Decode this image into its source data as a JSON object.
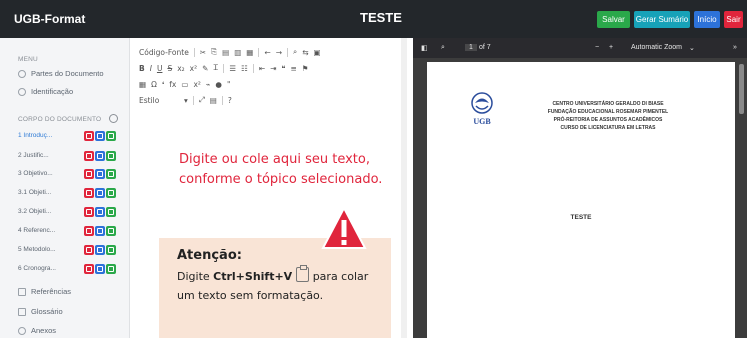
{
  "app": {
    "brand": "UGB-Format",
    "title": "TESTE",
    "actions": [
      {
        "label": "Salvar",
        "color": "#2aa84a"
      },
      {
        "label": "Gerar Sumário",
        "color": "#17a2b8"
      },
      {
        "label": "Início",
        "color": "#2d72d9"
      },
      {
        "label": "Sair",
        "color": "#e0253c"
      }
    ]
  },
  "sidebar": {
    "menu_heading": "MENU",
    "menu_items": [
      {
        "label": "Partes do Documento",
        "icon": "grid-icon"
      },
      {
        "label": "Identificação",
        "icon": "user-icon"
      }
    ],
    "body_heading": "CORPO DO DOCUMENTO",
    "topics": [
      {
        "label": "1 Introduç...",
        "active": true,
        "buttons": [
          "red",
          "blue",
          "green"
        ]
      },
      {
        "label": "2 Justific...",
        "active": false,
        "buttons": [
          "red",
          "blue",
          "green"
        ]
      },
      {
        "label": "3 Objetivo...",
        "active": false,
        "buttons": [
          "red",
          "blue",
          "green"
        ]
      },
      {
        "label": "3.1 Objeti...",
        "active": false,
        "buttons": [
          "red",
          "blue",
          "green"
        ]
      },
      {
        "label": "3.2 Objeti...",
        "active": false,
        "buttons": [
          "red",
          "blue",
          "green"
        ]
      },
      {
        "label": "4 Referenc...",
        "active": false,
        "buttons": [
          "red",
          "blue",
          "green"
        ]
      },
      {
        "label": "5 Metodolo...",
        "active": false,
        "buttons": [
          "red",
          "blue",
          "green"
        ]
      },
      {
        "label": "6 Cronogra...",
        "active": false,
        "buttons": [
          "red",
          "blue",
          "green"
        ]
      }
    ],
    "extra_items": [
      {
        "label": "Referências",
        "icon": "book-icon"
      },
      {
        "label": "Glossário",
        "icon": "text-icon"
      },
      {
        "label": "Anexos",
        "icon": "paperclip-icon"
      }
    ]
  },
  "editor": {
    "toolbar_row1": [
      "Código-Fonte"
    ],
    "toolbar_row2": [
      "B",
      "I",
      "U",
      "S",
      "x₂",
      "x²"
    ],
    "toolbar_row3": [
      "Ω",
      "fx"
    ],
    "style_select": "Estilo",
    "help": "?",
    "prompt": "Digite ou cole aqui seu texto, conforme o tópico selecionado.",
    "attention_title": "Atenção:",
    "attention_prefix": "Digite",
    "attention_keys": "Ctrl+Shift+V",
    "attention_suffix": "para colar um texto sem formatação."
  },
  "pdf": {
    "page_label": "1",
    "page_total": "of 7",
    "zoom": "Automatic Zoom",
    "logo_text": "UGB",
    "institution": [
      "CENTRO UNIVERSITÁRIO GERALDO DI BIASE",
      "FUNDAÇÃO EDUCACIONAL ROSEMAR PIMENTEL",
      "PRÓ-REITORIA DE ASSUNTOS ACADÊMICOS",
      "CURSO DE LICENCIATURA EM LETRAS"
    ],
    "doc_title": "TESTE"
  }
}
